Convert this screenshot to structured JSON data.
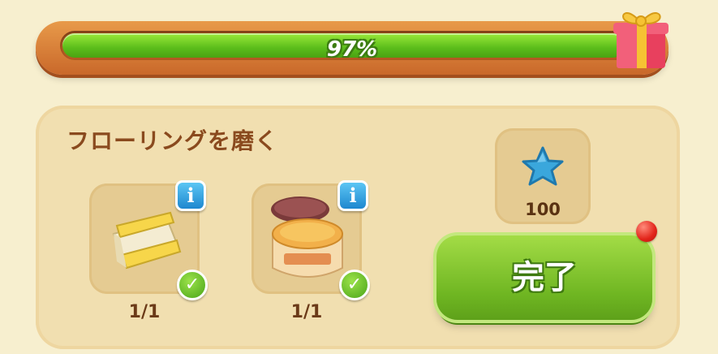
{
  "progress": {
    "value": 0.97,
    "label": "97%"
  },
  "task": {
    "title": "フローリングを磨く",
    "items": [
      {
        "name": "cloth",
        "count": "1/1",
        "info_icon": "info-icon",
        "status_icon": "checkmark-icon"
      },
      {
        "name": "polish-jar",
        "count": "1/1",
        "info_icon": "info-icon",
        "status_icon": "checkmark-icon"
      }
    ],
    "reward": {
      "icon": "blue-star-icon",
      "amount": "100"
    },
    "complete_label": "完了"
  },
  "colors": {
    "progress_fill": "#5bbd1b",
    "progress_frame": "#c9682a",
    "panel": "#f1dfb0",
    "title_text": "#8a4a1e",
    "complete_button": "#6fb622",
    "info_button": "#1e87cf",
    "notification_dot": "#e2241a",
    "star": "#3aa7dc"
  }
}
